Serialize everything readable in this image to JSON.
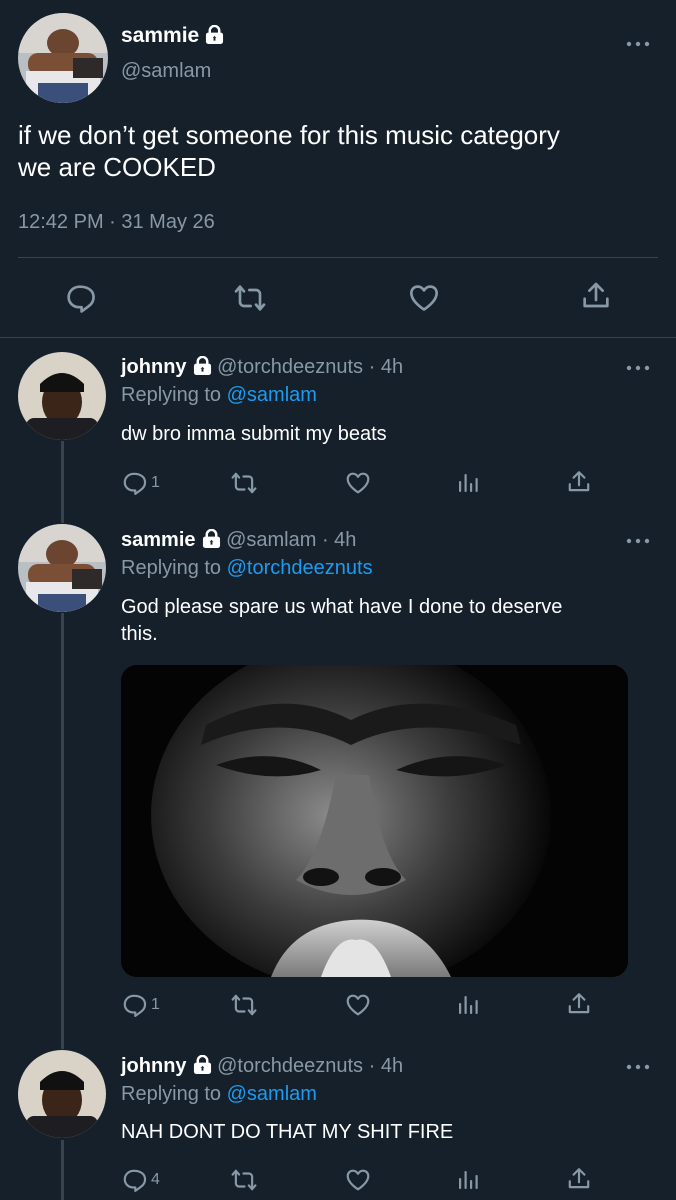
{
  "main_tweet": {
    "display_name": "sammie",
    "handle": "@samlam",
    "text_line1": "if we don’t get someone for this music category",
    "text_line2": "we are COOKED",
    "timestamp": "12:42 PM · 31 May 26"
  },
  "replies": [
    {
      "display_name": "johnny",
      "handle": "@torchdeeznuts",
      "time": "· 4h",
      "replying_label": "Replying to",
      "replying_to": "@samlam",
      "text": "dw bro imma submit my beats",
      "reply_count": "1"
    },
    {
      "display_name": "sammie",
      "handle": "@samlam",
      "time": "· 4h",
      "replying_label": "Replying to",
      "replying_to": "@torchdeeznuts",
      "text_line1": "God please spare us what have I done to deserve",
      "text_line2": "this.",
      "reply_count": "1"
    },
    {
      "display_name": "johnny",
      "handle": "@torchdeeznuts",
      "time": "· 4h",
      "replying_label": "Replying to",
      "replying_to": "@samlam",
      "text": "NAH DONT DO THAT MY SHIT FIRE",
      "reply_count": "4"
    }
  ],
  "icons": [
    "reply-icon",
    "retweet-icon",
    "like-icon",
    "share-icon",
    "analytics-icon",
    "lock-icon",
    "more-icon"
  ],
  "colors": {
    "background": "#15202b",
    "muted": "#8899a6",
    "link": "#1d9bf0",
    "divider": "#38444d"
  }
}
